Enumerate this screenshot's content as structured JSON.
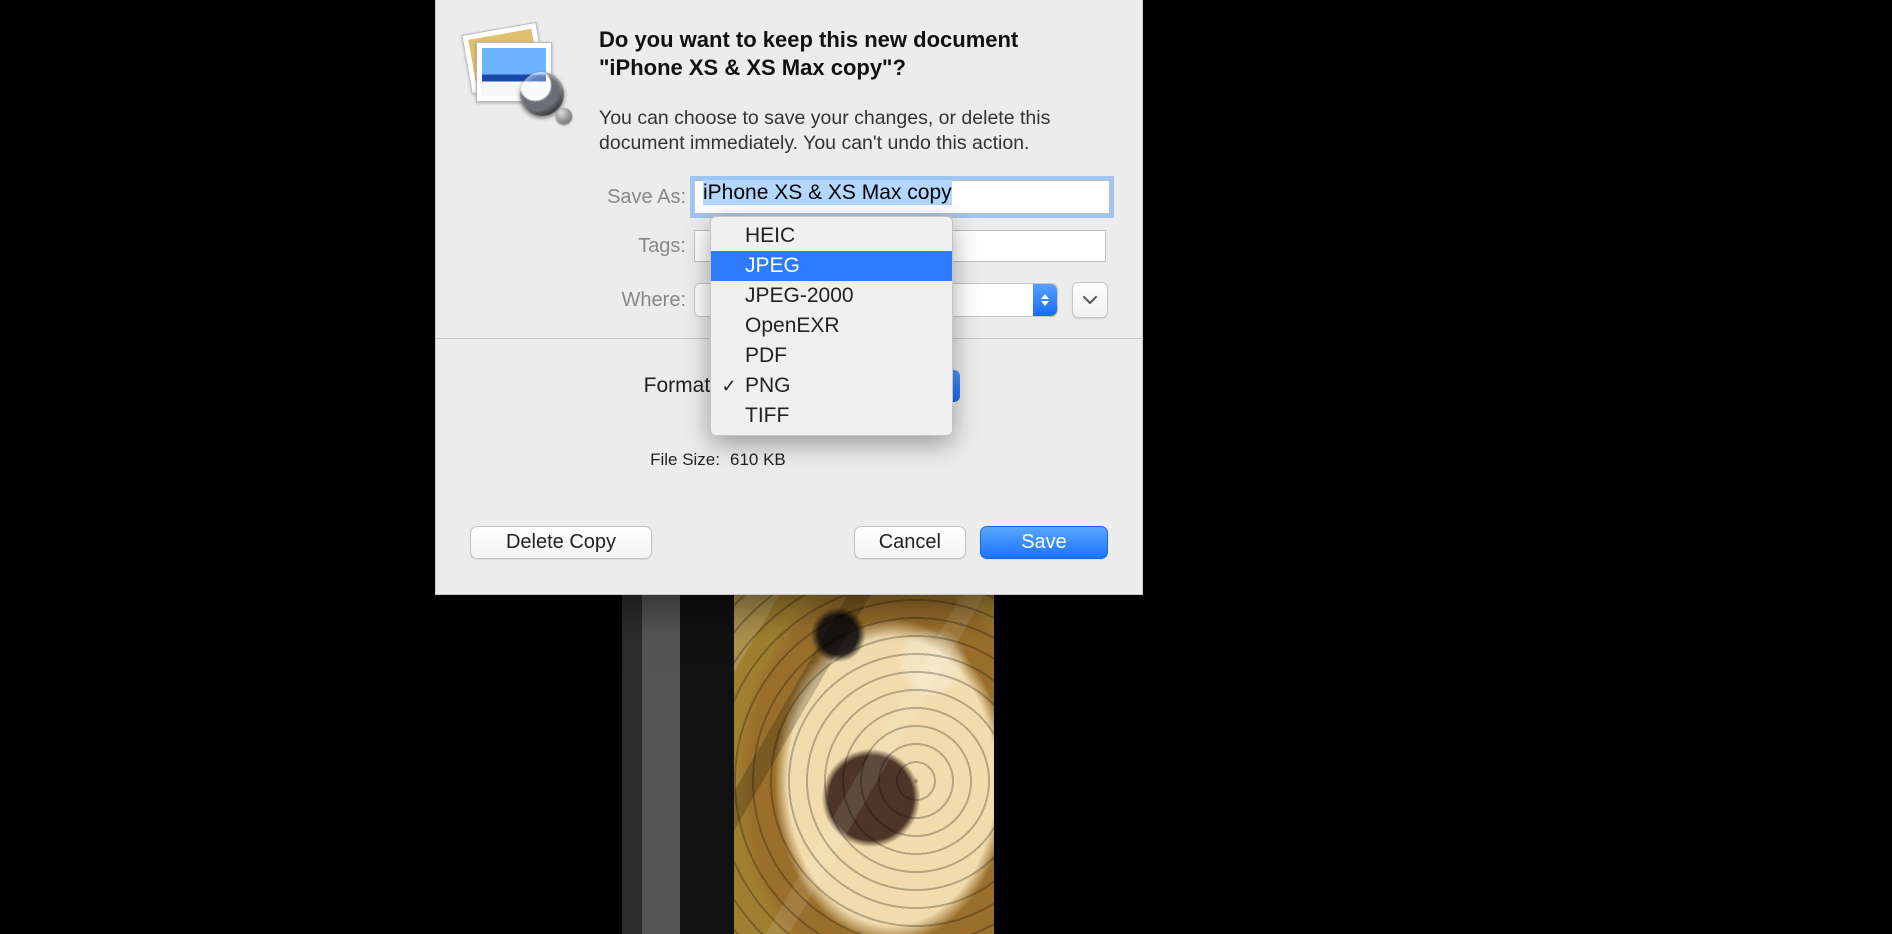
{
  "dialog": {
    "heading": "Do you want to keep this new document \"iPhone XS & XS Max copy\"?",
    "message": "You can choose to save your changes, or delete this document immediately. You can't undo this action.",
    "labels": {
      "save_as": "Save As:",
      "tags": "Tags:",
      "where": "Where:",
      "format": "Format:",
      "file_size": "File Size:"
    },
    "save_as_value": "iPhone XS & XS Max copy",
    "tags_value": "",
    "where_value": "",
    "file_size_value": "610 KB",
    "buttons": {
      "delete": "Delete Copy",
      "cancel": "Cancel",
      "save": "Save"
    }
  },
  "format_menu": {
    "options": [
      {
        "label": "HEIC",
        "checked": false,
        "hovered": false
      },
      {
        "label": "JPEG",
        "checked": false,
        "hovered": true
      },
      {
        "label": "JPEG-2000",
        "checked": false,
        "hovered": false
      },
      {
        "label": "OpenEXR",
        "checked": false,
        "hovered": false
      },
      {
        "label": "PDF",
        "checked": false,
        "hovered": false
      },
      {
        "label": "PNG",
        "checked": true,
        "hovered": false
      },
      {
        "label": "TIFF",
        "checked": false,
        "hovered": false
      }
    ]
  }
}
